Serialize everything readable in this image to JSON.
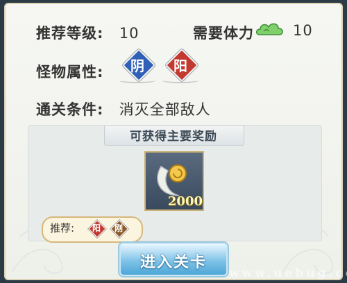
{
  "stats": {
    "recommended_level_label": "推荐等级:",
    "recommended_level_value": "10",
    "stamina_label": "需要体力",
    "stamina_icon": "cloud-stamina-icon",
    "stamina_value": "10"
  },
  "monster": {
    "label": "怪物属性:",
    "attributes": [
      {
        "text": "阴",
        "color": "#2f5fb6"
      },
      {
        "text": "阳",
        "color": "#c23a2f"
      }
    ]
  },
  "clear_condition": {
    "label": "通关条件:",
    "value": "消灭全部敌人"
  },
  "reward": {
    "title": "可获得主要奖励",
    "item_icon": "gold-coin-crescent-icon",
    "item_count": "2000"
  },
  "recommend": {
    "label": "推荐:",
    "tags": [
      {
        "text": "阳",
        "color": "#c23a2f"
      },
      {
        "text": "刚",
        "color": "#8a5a2b"
      }
    ]
  },
  "enter_button": "进入关卡",
  "watermark": "www.uebug.co"
}
